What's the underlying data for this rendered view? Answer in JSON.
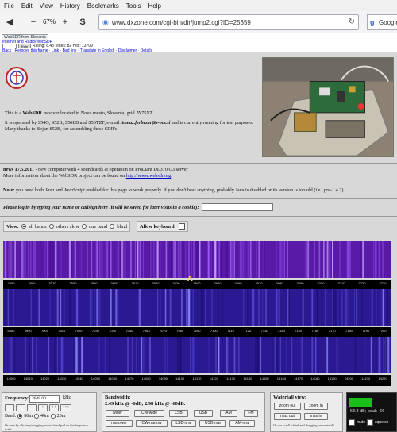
{
  "menu": [
    "File",
    "Edit",
    "View",
    "History",
    "Bookmarks",
    "Tools",
    "Help"
  ],
  "toolbar": {
    "zoom": "67%",
    "url": "www.dxzone.com/cgi-bin/dir/jump2.cgi?ID=25359",
    "search": "Google"
  },
  "frame": {
    "title": "WebSDR from Slovenia",
    "crumb": "Internet and Radio/WebSDR",
    "rating": "Rating: 8.43 Votes: 82 Hits: 13709",
    "rate_button": "Rate",
    "links": "Back · Remove this frame · Link · Bad link · Translate in English · Disclaimer · Details"
  },
  "intro": {
    "p1_pre": "This is a ",
    "p1_bold": "WebSDR",
    "p1_post": " receiver located in Novo mesto, Slovenia, grid ",
    "p1_grid": "JN75NT",
    "p1_end": ".",
    "p2_pre": "It is operated by S54O, S52B, S56LB and S56TZF, e-mail: ",
    "p2_email": "tomaz.ferbezar@s-om.si",
    "p2_post": " and is currently running for test purposes. Many thanks to Bojan S52B, for assembling these SDR's!"
  },
  "news": {
    "bold": "news 17.5.2011",
    "text": " - new computer with 4 soundcards at operation on ProLiant DL370 G3 server",
    "line2_pre": "More information about the WebSDR project can be found on ",
    "link": "http://www.websdr.org",
    "line2_post": "."
  },
  "note": {
    "bold": "Note:",
    "pre": " you need both ",
    "java": "Java",
    "mid": " and ",
    "js": "JavaScript",
    "post": " enabled for this page to work properly. If you don't hear anything, probably Java is disabled or its version is too old (i.e., pre-1.4.2)."
  },
  "login": {
    "text": "Please log in by typing your name or callsign here (it will be saved for later visits in a cookie):"
  },
  "view": {
    "label": "View:",
    "options": [
      "all bands",
      "others slow",
      "one band",
      "blind"
    ],
    "keyboard": "Allow keyboard:"
  },
  "bands": [
    {
      "ticks": [
        "3550",
        "3560",
        "3570",
        "3580",
        "3590",
        "3600",
        "3610",
        "3620",
        "3630",
        "3640",
        "3650",
        "3660",
        "3670",
        "3680",
        "3690",
        "3700",
        "3710",
        "3720",
        "3730"
      ]
    },
    {
      "ticks": [
        "6980",
        "6990",
        "7000",
        "7010",
        "7020",
        "7030",
        "7040",
        "7050",
        "7060",
        "7070",
        "7080",
        "7090",
        "7100",
        "7110",
        "7120",
        "7130",
        "7140",
        "7150",
        "7160",
        "7170",
        "7180",
        "7190",
        "7200"
      ]
    },
    {
      "ticks": [
        "14000",
        "14010",
        "14020",
        "14030",
        "14040",
        "14050",
        "14060",
        "14070",
        "14080",
        "14090",
        "14100",
        "14110",
        "14120",
        "14130",
        "14140",
        "14150",
        "14160",
        "14170",
        "14180",
        "14190",
        "14200",
        "14210",
        "14220"
      ]
    }
  ],
  "freq": {
    "label": "Frequency:",
    "value": "3648.00",
    "unit": "kHz",
    "buttons": [
      "---",
      "--",
      "-",
      "+",
      "++",
      "+++"
    ],
    "band_label": "Band:",
    "bands": [
      "80m",
      "40m",
      "20m"
    ],
    "hint": "Or tune by clicking/dragging mouse/trackpad on the frequency scale."
  },
  "bw": {
    "label": "Bandwidth:",
    "v1": "2.49 kHz @ -6dB;",
    "v2": "2.98 kHz @ -60dB.",
    "row1": [
      "wider",
      "CW-wide",
      "LSB",
      "USB",
      "AM",
      "FM"
    ],
    "row2": [
      "narrower",
      "CW-narrow",
      "LSB-nrw",
      "USB-nrw",
      "AM-nrw"
    ]
  },
  "wfv": {
    "label": "Waterfall view:",
    "row1": [
      "zoom out",
      "zoom in"
    ],
    "row2": [
      "max out",
      "max in"
    ],
    "hint": "Or use scroll wheel and dragging on waterfall."
  },
  "meter": {
    "text": "-68.3 dB; peak -66",
    "mute": "mute",
    "squelch": "squelch",
    "level": 0.5
  }
}
